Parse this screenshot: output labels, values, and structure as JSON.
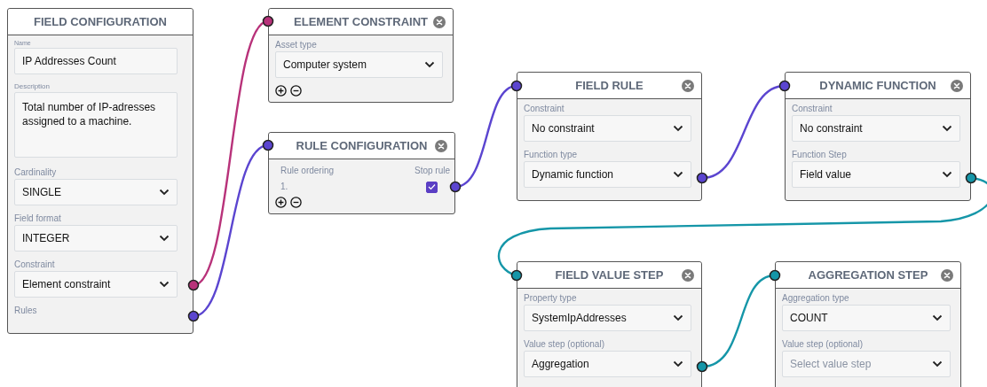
{
  "nodes": [
    {
      "title": "FIELD CONFIGURATION",
      "closable": false,
      "add_remove": false,
      "fields": [
        {
          "kind": "text",
          "label": "Name",
          "value": "IP Addresses Count"
        },
        {
          "kind": "textarea",
          "label": "Description",
          "value": "Total number of IP-adresses assigned to a machine."
        },
        {
          "kind": "select",
          "label": "Cardinality",
          "value": "SINGLE"
        },
        {
          "kind": "select",
          "label": "Field format",
          "value": "INTEGER"
        },
        {
          "kind": "select",
          "label": "Constraint",
          "value": "Element constraint"
        },
        {
          "kind": "port",
          "label": "Rules"
        }
      ]
    },
    {
      "title": "ELEMENT CONSTRAINT",
      "closable": true,
      "add_remove": true,
      "fields": [
        {
          "kind": "select",
          "label": "Asset type",
          "value": "Computer system"
        }
      ]
    },
    {
      "title": "RULE CONFIGURATION",
      "closable": true,
      "add_remove": true,
      "fields": [
        {
          "kind": "rules",
          "headers": [
            "Rule ordering",
            "Stop rule"
          ],
          "rows": [
            {
              "order": "1.",
              "checked": true
            }
          ]
        }
      ]
    },
    {
      "title": "FIELD RULE",
      "closable": true,
      "add_remove": false,
      "fields": [
        {
          "kind": "select",
          "label": "Constraint",
          "value": "No constraint"
        },
        {
          "kind": "select",
          "label": "Function type",
          "value": "Dynamic function"
        }
      ]
    },
    {
      "title": "DYNAMIC FUNCTION",
      "closable": true,
      "add_remove": false,
      "fields": [
        {
          "kind": "select",
          "label": "Constraint",
          "value": "No constraint"
        },
        {
          "kind": "select",
          "label": "Function Step",
          "value": "Field value"
        }
      ]
    },
    {
      "title": "FIELD VALUE STEP",
      "closable": true,
      "add_remove": false,
      "fields": [
        {
          "kind": "select",
          "label": "Property type",
          "value": "SystemIpAddresses"
        },
        {
          "kind": "select",
          "label": "Value step (optional)",
          "value": "Aggregation"
        }
      ]
    },
    {
      "title": "AGGREGATION STEP",
      "closable": true,
      "add_remove": false,
      "fields": [
        {
          "kind": "select",
          "label": "Aggregation type",
          "value": "COUNT"
        },
        {
          "kind": "select",
          "label": "Value step (optional)",
          "placeholder": "Select value step"
        }
      ]
    }
  ],
  "connections": [
    {
      "color": "#b8327a"
    },
    {
      "color": "#5b45d0"
    },
    {
      "color": "#5b45d0"
    },
    {
      "color": "#5b45d0"
    },
    {
      "color": "#1596a8"
    },
    {
      "color": "#1596a8"
    }
  ]
}
